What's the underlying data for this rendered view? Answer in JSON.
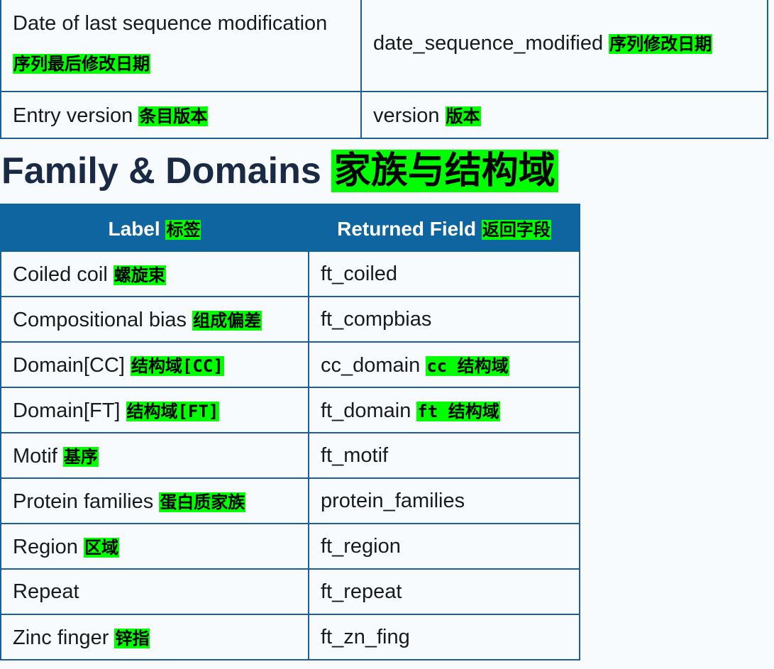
{
  "top_table": {
    "rows": [
      {
        "label": "Date of last sequence modification",
        "label_zh": "序列最后修改日期",
        "field": "date_sequence_modified",
        "field_zh": "序列修改日期"
      },
      {
        "label": "Entry version",
        "label_zh": "条目版本",
        "field": "version",
        "field_zh": "版本"
      }
    ]
  },
  "section": {
    "title": "Family & Domains",
    "title_zh": "家族与结构域"
  },
  "table": {
    "header": {
      "label": "Label",
      "label_zh": "标签",
      "field": "Returned Field",
      "field_zh": "返回字段"
    },
    "rows": [
      {
        "label": "Coiled coil",
        "label_zh": "螺旋束",
        "field": "ft_coiled",
        "field_zh": ""
      },
      {
        "label": "Compositional bias",
        "label_zh": "组成偏差",
        "field": "ft_compbias",
        "field_zh": ""
      },
      {
        "label": "Domain[CC]",
        "label_zh": "结构域[CC]",
        "field": "cc_domain",
        "field_zh": "cc 结构域"
      },
      {
        "label": "Domain[FT]",
        "label_zh": "结构域[FT]",
        "field": "ft_domain",
        "field_zh": "ft 结构域"
      },
      {
        "label": "Motif",
        "label_zh": "基序",
        "field": "ft_motif",
        "field_zh": ""
      },
      {
        "label": "Protein families",
        "label_zh": "蛋白质家族",
        "field": "protein_families",
        "field_zh": ""
      },
      {
        "label": "Region",
        "label_zh": "区域",
        "field": "ft_region",
        "field_zh": ""
      },
      {
        "label": "Repeat",
        "label_zh": "",
        "field": "ft_repeat",
        "field_zh": ""
      },
      {
        "label": "Zinc finger",
        "label_zh": "锌指",
        "field": "ft_zn_fing",
        "field_zh": ""
      }
    ]
  },
  "colors": {
    "highlight": "#00ff00",
    "header_bg": "#0e65a0",
    "border": "#1f5f8f",
    "title": "#1b2a44"
  }
}
